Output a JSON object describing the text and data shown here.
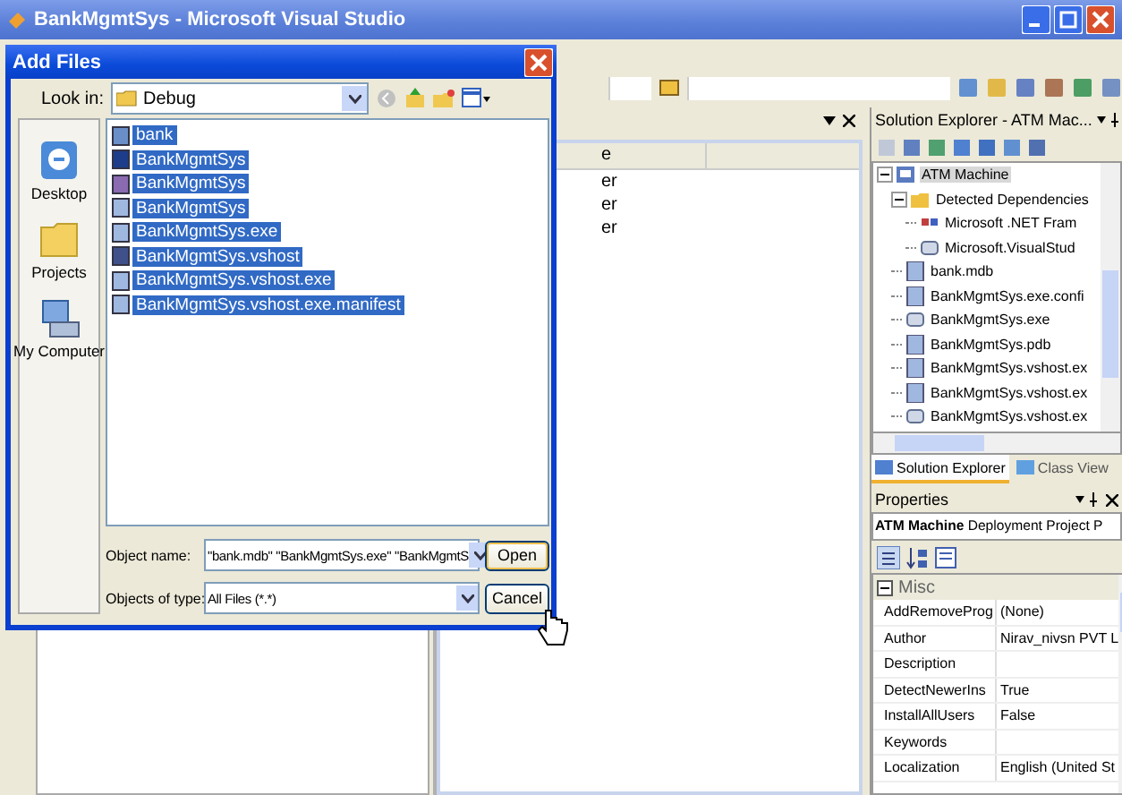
{
  "window": {
    "title": "BankMgmtSys - Microsoft Visual Studio"
  },
  "document_panel": {
    "column_1_header": "e",
    "rows": [
      "er",
      "er",
      "er"
    ]
  },
  "solution_explorer": {
    "title": "Solution Explorer - ATM Mac...",
    "tree": [
      {
        "label": "ATM Machine",
        "kind": "project",
        "selected": true,
        "expanded": true,
        "children": [
          {
            "label": "Detected Dependencies",
            "kind": "folder",
            "selected": false,
            "expanded": true,
            "children": [
              {
                "label": "Microsoft .NET Fram",
                "kind": "reference",
                "selected": false
              },
              {
                "label": "Microsoft.VisualStud",
                "kind": "module",
                "selected": false
              }
            ]
          },
          {
            "label": "bank.mdb",
            "kind": "file",
            "selected": false
          },
          {
            "label": "BankMgmtSys.exe.confi",
            "kind": "file",
            "selected": false
          },
          {
            "label": "BankMgmtSys.exe",
            "kind": "module",
            "selected": false
          },
          {
            "label": "BankMgmtSys.pdb",
            "kind": "file",
            "selected": false
          },
          {
            "label": "BankMgmtSys.vshost.ex",
            "kind": "file",
            "selected": false
          },
          {
            "label": "BankMgmtSys.vshost.ex",
            "kind": "file",
            "selected": false
          },
          {
            "label": "BankMgmtSys.vshost.ex",
            "kind": "module",
            "selected": false
          }
        ]
      }
    ]
  },
  "bottom_tabs": [
    {
      "label": "Solution Explorer",
      "selected": true
    },
    {
      "label": "Class View",
      "selected": false
    }
  ],
  "properties": {
    "title": "Properties",
    "object_name": "ATM Machine",
    "object_type": "Deployment Project P",
    "category": {
      "label": "Misc",
      "expanded": true
    },
    "rows": [
      {
        "name": "AddRemoveProg",
        "value": "(None)"
      },
      {
        "name": "Author",
        "value": "Nirav_nivsn PVT L"
      },
      {
        "name": "Description"
      },
      {
        "name": "DetectNewerIns",
        "value": "True"
      },
      {
        "name": "InstallAllUsers",
        "value": "False"
      },
      {
        "name": "Keywords"
      },
      {
        "name": "Localization",
        "value": "English (United St"
      }
    ]
  },
  "dialog": {
    "title": "Add Files",
    "look_in_label": "Look in:",
    "look_in_value": "Debug",
    "places": [
      {
        "label": "Desktop",
        "kind": "desktop"
      },
      {
        "label": "Projects",
        "kind": "folder"
      },
      {
        "label": "My Computer",
        "kind": "computer"
      }
    ],
    "files": [
      {
        "name": "bank",
        "kind": "db",
        "selected": true
      },
      {
        "name": "BankMgmtSys",
        "kind": "app",
        "selected": true
      },
      {
        "name": "BankMgmtSys",
        "kind": "globe",
        "selected": true
      },
      {
        "name": "BankMgmtSys",
        "kind": "doc",
        "selected": true
      },
      {
        "name": "BankMgmtSys.exe",
        "kind": "doc",
        "selected": true
      },
      {
        "name": "BankMgmtSys.vshost",
        "kind": "window",
        "selected": true
      },
      {
        "name": "BankMgmtSys.vshost.exe",
        "kind": "doc",
        "selected": true
      },
      {
        "name": "BankMgmtSys.vshost.exe.manifest",
        "kind": "doc",
        "selected": true
      }
    ],
    "object_name_label": "Object name:",
    "object_name_value": "\"bank.mdb\" \"BankMgmtSys.exe\" \"BankMgmtS",
    "object_type_label": "Objects of type:",
    "object_type_value": "All Files (*.*)",
    "buttons": [
      {
        "label": "Open",
        "kind": "default"
      },
      {
        "label": "Cancel",
        "kind": "normal"
      }
    ]
  }
}
